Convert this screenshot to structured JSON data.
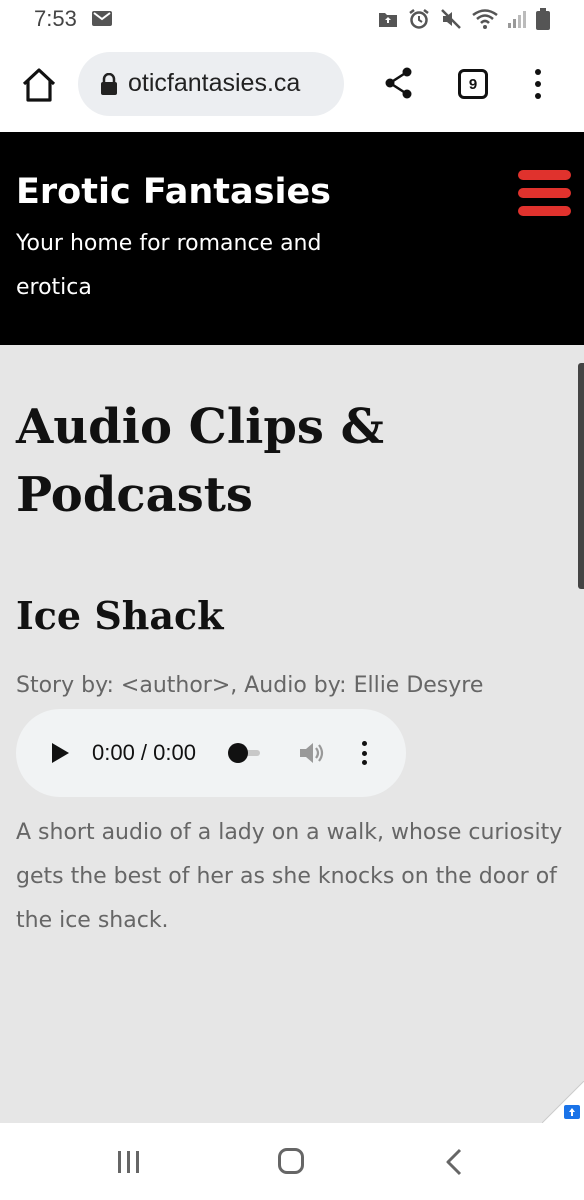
{
  "status_bar": {
    "time": "7:53",
    "icons": [
      "mail-icon",
      "vpn-icon",
      "alarm-icon",
      "mute-icon",
      "wifi-icon",
      "signal-icon",
      "battery-icon"
    ]
  },
  "browser": {
    "url": "oticfantasies.ca",
    "tab_count": "9",
    "icons": [
      "home-icon",
      "lock-icon",
      "share-icon",
      "tabs-icon",
      "more-icon"
    ]
  },
  "header": {
    "title": "Erotic Fantasies",
    "tagline": "Your home for romance and erotica",
    "menu_icon": "hamburger-icon",
    "accent_color": "#e0322d"
  },
  "main": {
    "page_title": "Audio Clips & Podcasts",
    "items": [
      {
        "title": "Ice Shack",
        "credits": "Story by: <author>, Audio by: Ellie Desyre",
        "audio": {
          "time": "0:00 / 0:00",
          "progress": 0
        },
        "description": "A short audio of a lady on a walk, whose curiosity gets the best of her as she knocks on the door of the ice shack."
      }
    ]
  },
  "nav_bar": {
    "icons": [
      "recents-icon",
      "home-icon",
      "back-icon"
    ]
  }
}
